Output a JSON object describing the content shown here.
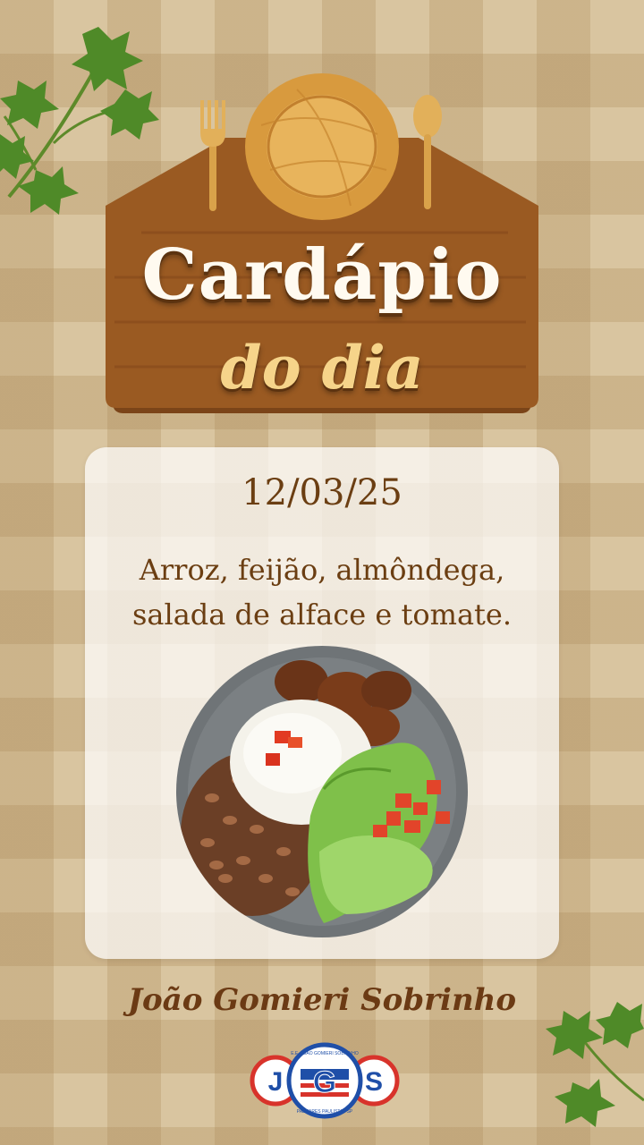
{
  "header": {
    "title": "Cardápio",
    "subtitle": "do dia"
  },
  "menu_card": {
    "date": "12/03/25",
    "items_line1": "Arroz, feijão, almôndega,",
    "items_line2": "salada de alface e tomate."
  },
  "footer": {
    "school_name": "João Gomieri Sobrinho",
    "logo": {
      "letters": [
        "J",
        "G",
        "S"
      ],
      "ring_text": "E.E. JOÃO GOMIERI SOBRINHO",
      "bottom_text": "PALMARES PAULISTA - SP"
    }
  },
  "icons": [
    "leaf-cluster-icon",
    "fork-icon",
    "plate-icon",
    "spoon-icon"
  ],
  "colors": {
    "background": "#d9c5a0",
    "sign_wood": "#9a5a22",
    "title_text": "#fffaf0",
    "subtitle_text": "#f6d48a",
    "body_text": "#6b3e12",
    "logo_blue": "#1f4fa8",
    "logo_red": "#d8332b"
  }
}
